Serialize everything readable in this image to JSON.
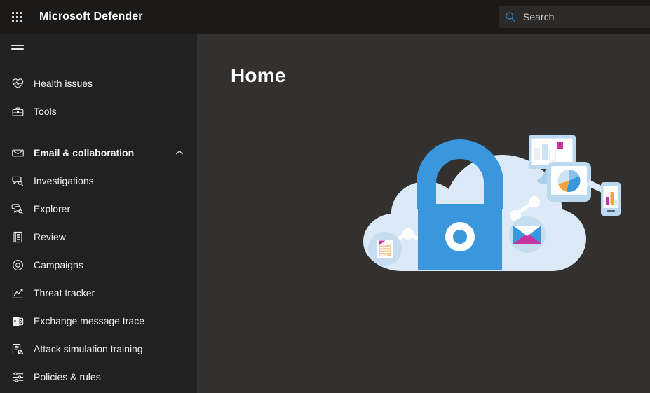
{
  "topbar": {
    "waffle_icon": "app-launcher-grid-icon",
    "brand": "Microsoft Defender",
    "search": {
      "icon": "search-icon",
      "placeholder": "Search",
      "value": ""
    }
  },
  "sidebar": {
    "hamburger_icon": "hamburger-menu-icon",
    "items": [
      {
        "label": "Health issues",
        "icon": "heart-pulse-icon",
        "type": "item"
      },
      {
        "label": "Tools",
        "icon": "toolbox-icon",
        "type": "item"
      },
      {
        "label": "divider",
        "icon": "",
        "type": "divider"
      },
      {
        "label": "Email & collaboration",
        "icon": "envelope-icon",
        "type": "group",
        "expanded": true,
        "chevron": "chevron-up-icon"
      },
      {
        "label": "Investigations",
        "icon": "investigation-search-icon",
        "type": "item"
      },
      {
        "label": "Explorer",
        "icon": "explorer-search-icon",
        "type": "item"
      },
      {
        "label": "Review",
        "icon": "document-list-icon",
        "type": "item"
      },
      {
        "label": "Campaigns",
        "icon": "target-circle-icon",
        "type": "item"
      },
      {
        "label": "Threat tracker",
        "icon": "line-chart-icon",
        "type": "item"
      },
      {
        "label": "Exchange message trace",
        "icon": "exchange-icon",
        "type": "item"
      },
      {
        "label": "Attack simulation training",
        "icon": "attack-simulation-icon",
        "type": "item"
      },
      {
        "label": "Policies & rules",
        "icon": "sliders-icon",
        "type": "item"
      }
    ]
  },
  "main": {
    "title": "Home",
    "illustration": {
      "name": "cloud-security-illustration",
      "elements": [
        "cloud",
        "padlock",
        "document-badge",
        "email-badge",
        "monitor-bar-chart",
        "tablet-pie-chart",
        "phone-bar-chart",
        "network-nodes"
      ]
    }
  },
  "colors": {
    "topbar_bg": "#1b1a19",
    "sidebar_bg": "#212121",
    "main_bg": "#323130",
    "text_primary": "#f3f2f1",
    "search_accent": "#2e8ad6",
    "illustration_cloud": "#dcebf7",
    "illustration_lock": "#3a96dd",
    "illustration_accent_magenta": "#c9339e",
    "illustration_accent_orange": "#f2a33c"
  }
}
